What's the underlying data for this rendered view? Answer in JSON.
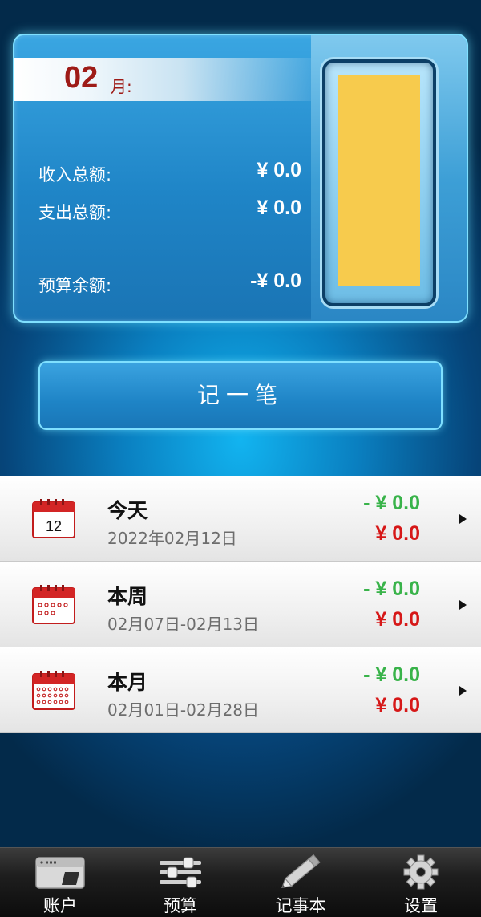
{
  "summary": {
    "month": "02",
    "month_unit": "月:",
    "income_label": "收入总额:",
    "income_value": "¥ 0.0",
    "expense_label": "支出总额:",
    "expense_value": "¥ 0.0",
    "budget_label": "预算余额:",
    "budget_value": "-¥ 0.0",
    "budget_fill_fraction": 1.0
  },
  "record_button": "记一笔",
  "periods": [
    {
      "title": "今天",
      "range": "2022年02月12日",
      "income": "- ¥ 0.0",
      "expense": "¥ 0.0",
      "icon": "calendar-day-icon",
      "day": "12"
    },
    {
      "title": "本周",
      "range": "02月07日-02月13日",
      "income": "- ¥ 0.0",
      "expense": "¥ 0.0",
      "icon": "calendar-week-icon"
    },
    {
      "title": "本月",
      "range": "02月01日-02月28日",
      "income": "- ¥ 0.0",
      "expense": "¥ 0.0",
      "icon": "calendar-month-icon"
    }
  ],
  "tabs": [
    {
      "label": "账户",
      "icon": "wallet-card-icon"
    },
    {
      "label": "预算",
      "icon": "sliders-icon"
    },
    {
      "label": "记事本",
      "icon": "pencil-icon"
    },
    {
      "label": "设置",
      "icon": "gear-icon"
    }
  ],
  "colors": {
    "accent_blue": "#1f85c7",
    "month_red": "#9e1b17",
    "income_green": "#39b34a",
    "expense_red": "#d61818",
    "gauge_yellow": "#f7cb4d"
  }
}
